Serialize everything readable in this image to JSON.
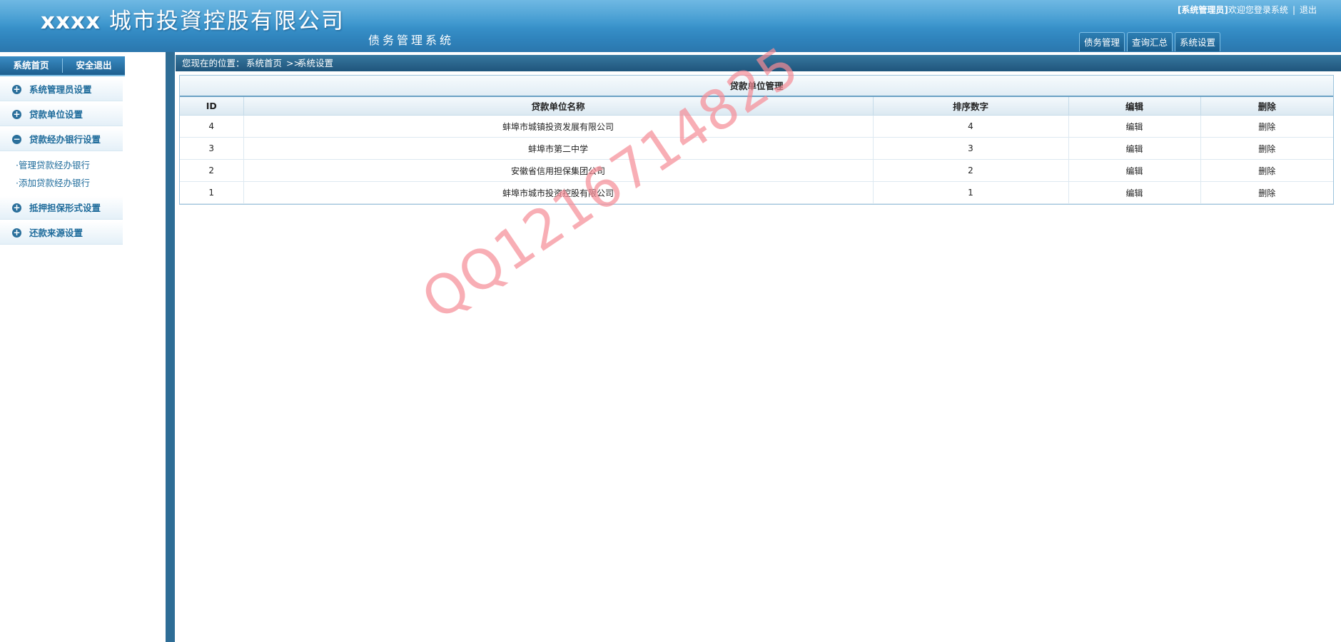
{
  "header": {
    "company_prefix": "xxxx",
    "company_name": "城市投資控股有限公司",
    "system_name": "债务管理系统",
    "user_role": "[系统管理员]",
    "welcome": "欢迎您登录系统",
    "separator": "|",
    "logout": "退出",
    "tabs": [
      {
        "label": "债务管理"
      },
      {
        "label": "查询汇总"
      },
      {
        "label": "系统设置"
      }
    ]
  },
  "sidebar": {
    "home": "系统首页",
    "safe_exit": "安全退出",
    "menus": [
      {
        "label": "系统管理员设置",
        "icon": "plus-circle-icon",
        "expanded": false
      },
      {
        "label": "贷款单位设置",
        "icon": "plus-circle-icon",
        "expanded": false
      },
      {
        "label": "贷款经办银行设置",
        "icon": "minus-circle-icon",
        "expanded": true,
        "children": [
          {
            "label": "·管理贷款经办银行"
          },
          {
            "label": "·添加贷款经办银行"
          }
        ]
      },
      {
        "label": "抵押担保形式设置",
        "icon": "plus-circle-icon",
        "expanded": false
      },
      {
        "label": "还款来源设置",
        "icon": "plus-circle-icon",
        "expanded": false
      }
    ]
  },
  "breadcrumb": {
    "prefix": "您现在的位置：",
    "items": [
      "系统首页",
      ">>",
      "系统设置"
    ]
  },
  "panel": {
    "title": "贷款单位管理",
    "columns": [
      "ID",
      "贷款单位名称",
      "排序数字",
      "编辑",
      "删除"
    ],
    "rows": [
      {
        "id": "4",
        "name": "蚌埠市城镇投资发展有限公司",
        "order": "4",
        "edit": "编辑",
        "delete": "删除"
      },
      {
        "id": "3",
        "name": "蚌埠市第二中学",
        "order": "3",
        "edit": "编辑",
        "delete": "删除"
      },
      {
        "id": "2",
        "name": "安徽省信用担保集团公司",
        "order": "2",
        "edit": "编辑",
        "delete": "删除"
      },
      {
        "id": "1",
        "name": "蚌埠市城市投资控股有限公司",
        "order": "1",
        "edit": "编辑",
        "delete": "删除"
      }
    ]
  },
  "watermark": "QQ1216714825",
  "colors": {
    "header_blue": "#3a95cd",
    "nav_dark": "#1f557c",
    "link_blue": "#1e6b9b",
    "watermark_pink": "#f58c96"
  }
}
